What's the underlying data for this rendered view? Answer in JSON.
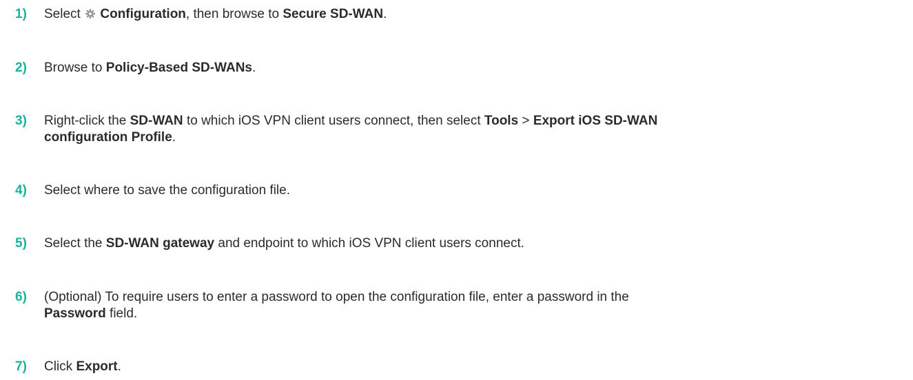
{
  "steps": [
    {
      "number": "1)",
      "parts": [
        "Select ",
        "Configuration",
        ", then browse to ",
        "Secure SD-WAN",
        "."
      ],
      "icon": "gear-icon"
    },
    {
      "number": "2)",
      "parts": [
        "Browse to ",
        "Policy-Based SD-WANs",
        "."
      ]
    },
    {
      "number": "3)",
      "parts": [
        "Right-click the ",
        "SD-WAN",
        " to which iOS VPN client users connect, then select ",
        "Tools",
        " > ",
        "Export iOS SD-WAN",
        "configuration Profile",
        "."
      ]
    },
    {
      "number": "4)",
      "parts": [
        "Select where to save the configuration file."
      ]
    },
    {
      "number": "5)",
      "parts": [
        "Select the ",
        "SD-WAN gateway",
        " and endpoint to which iOS VPN client users connect."
      ]
    },
    {
      "number": "6)",
      "parts": [
        "(Optional) To require users to enter a password to open the configuration file, enter a password in the",
        "Password",
        " field."
      ]
    },
    {
      "number": "7)",
      "parts": [
        "Click ",
        "Export",
        "."
      ]
    }
  ],
  "colors": {
    "step_number": "#19b39c",
    "text": "#2b2b2b",
    "icon": "#9a9a9a"
  }
}
